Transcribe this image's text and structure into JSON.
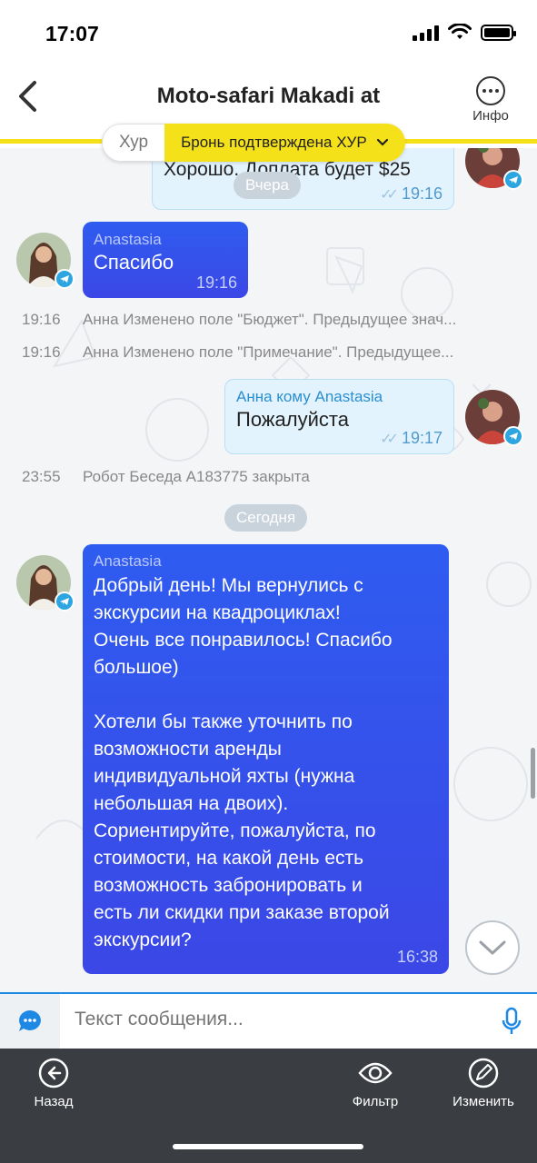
{
  "status_bar": {
    "time": "17:07"
  },
  "nav": {
    "title": "Moto-safari Makadi at",
    "info_label": "Инфо"
  },
  "status_pill": {
    "left": "Хур",
    "right": "Бронь подтверждена ХУР"
  },
  "messages": {
    "m0": {
      "text": "Хорошо. Доплата будет $25",
      "time": "19:16"
    },
    "m1": {
      "sender": "Anastasia",
      "text": "Спасибо",
      "time": "19:16"
    },
    "sys1": {
      "time": "19:16",
      "text": "Анна Изменено поле \"Бюджет\". Предыдущее знач..."
    },
    "sys2": {
      "time": "19:16",
      "text": "Анна Изменено поле \"Примечание\". Предыдущее..."
    },
    "m2": {
      "sender": "Анна кому Anastasia",
      "text": "Пожалуйста",
      "time": "19:17"
    },
    "sys3": {
      "time": "23:55",
      "text": "Робот Беседа A183775 закрыта"
    },
    "m3": {
      "sender": "Anastasia",
      "text": "Добрый день! Мы вернулись с\nэкскурсии на квадроциклах!\nОчень все понравилось! Спасибо\nбольшое)\n\nХотели бы также уточнить по\nвозможности аренды\nиндивидуальной яхты (нужна\nнебольшая на двоих).\nСориентируйте, пожалуйста, по\nстоимости, на какой день есть\nвозможность забронировать и\nесть ли скидки при заказе второй\nэкскурсии?",
      "time": "16:38"
    }
  },
  "dates": {
    "yesterday": "Вчера",
    "today": "Сегодня"
  },
  "composer": {
    "placeholder": "Текст сообщения..."
  },
  "tabs": {
    "back": "Назад",
    "filter": "Фильтр",
    "edit": "Изменить"
  },
  "colors": {
    "accent_yellow": "#f5e11a",
    "incoming_bubble": "#3b4fe8",
    "outgoing_bubble": "#e3f3fd",
    "tab_bar": "#3a3d42",
    "telegram": "#2ca5e0"
  },
  "icons": [
    "back-chevron-icon",
    "more-icon",
    "chevron-down-icon",
    "telegram-icon",
    "chat-icon",
    "mic-icon",
    "back-arrow-icon",
    "eye-icon",
    "pencil-icon",
    "scroll-down-icon"
  ]
}
